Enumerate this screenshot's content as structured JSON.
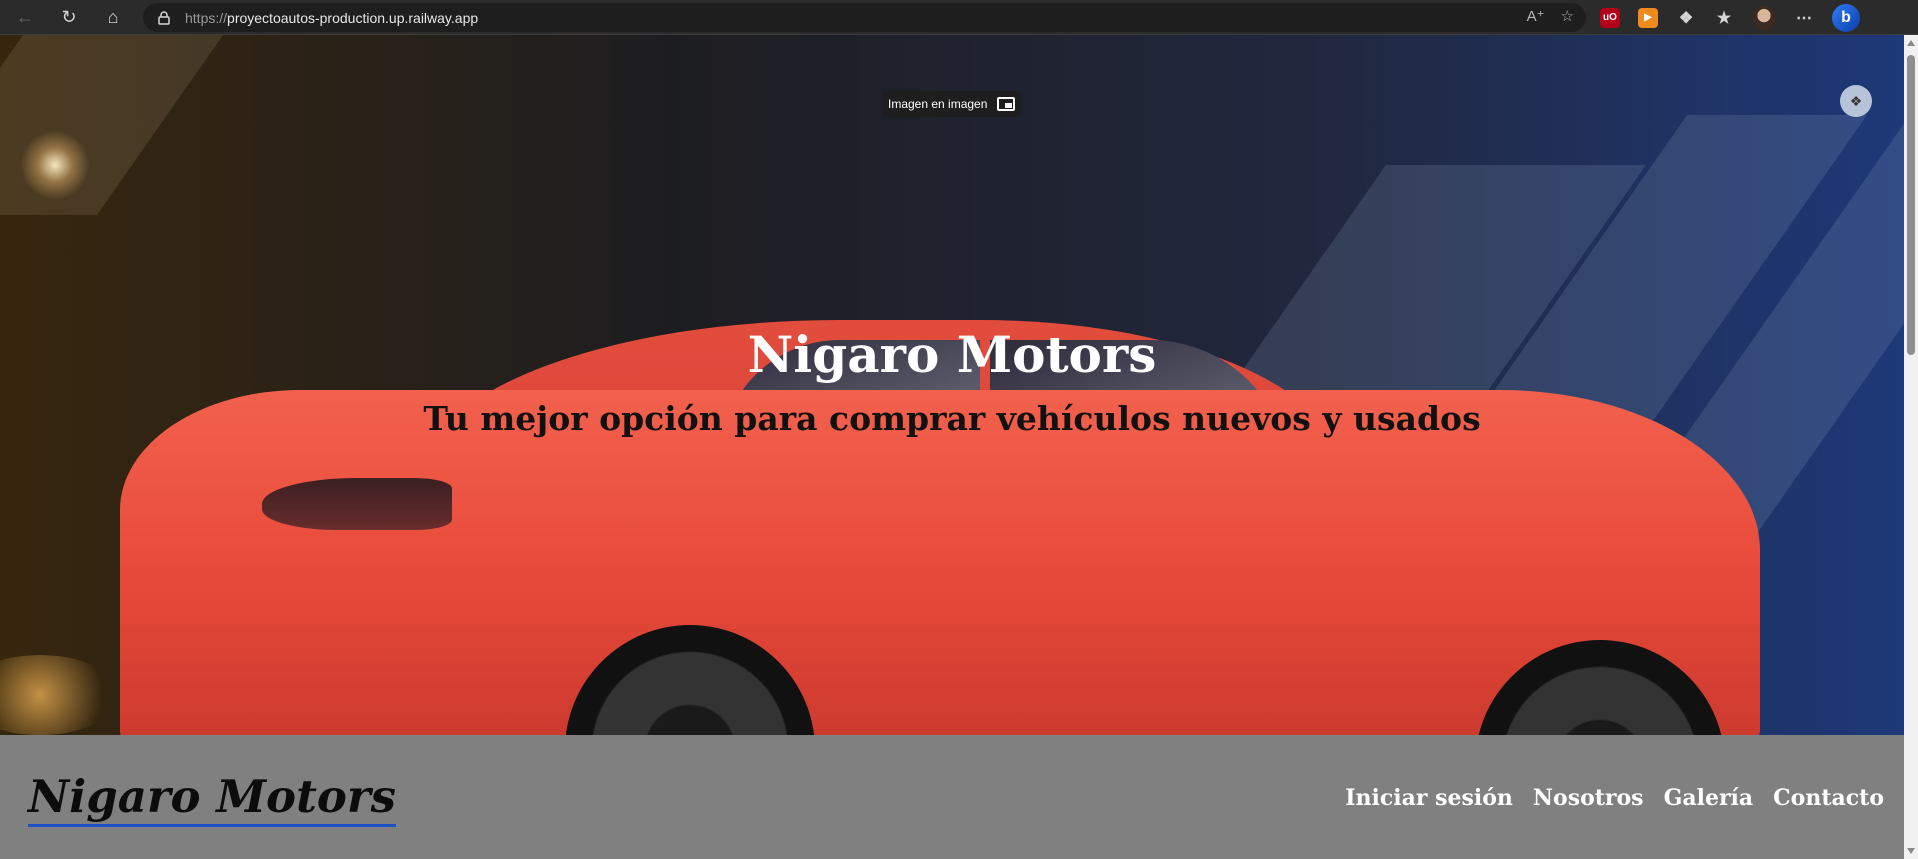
{
  "browser": {
    "url_scheme": "https://",
    "url_host": "proyectoautos-production.up.railway.app",
    "extensions": {
      "ublock_label": "uO"
    }
  },
  "hero": {
    "title": "Nigaro Motors",
    "subtitle": "Tu mejor opción para comprar vehículos nuevos y usados",
    "pip_label": "Imagen en imagen"
  },
  "navbar": {
    "brand": "Nigaro Motors",
    "links": [
      "Iniciar sesión",
      "Nosotros",
      "Galería",
      "Contacto"
    ]
  },
  "colors": {
    "hero_car": "#e84a3a",
    "nav_background": "#808080",
    "brand_underline": "#1f4fc4"
  }
}
